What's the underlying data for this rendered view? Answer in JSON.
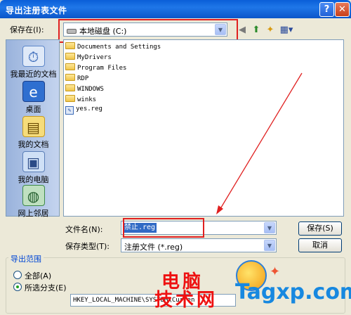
{
  "window": {
    "title": "导出注册表文件",
    "help": "?",
    "close": "✕"
  },
  "save_in": {
    "label": "保存在(I):",
    "value": "本地磁盘 (C:)"
  },
  "places": [
    {
      "label": "我最近的文档",
      "icon": "recent-documents-icon"
    },
    {
      "label": "桌面",
      "icon": "desktop-icon"
    },
    {
      "label": "我的文档",
      "icon": "my-documents-icon"
    },
    {
      "label": "我的电脑",
      "icon": "my-computer-icon"
    },
    {
      "label": "网上邻居",
      "icon": "network-places-icon"
    }
  ],
  "files": [
    {
      "name": "Documents and Settings",
      "type": "folder"
    },
    {
      "name": "MyDrivers",
      "type": "folder"
    },
    {
      "name": "Program Files",
      "type": "folder"
    },
    {
      "name": "RDP",
      "type": "folder"
    },
    {
      "name": "WINDOWS",
      "type": "folder"
    },
    {
      "name": "winks",
      "type": "folder"
    },
    {
      "name": "yes.reg",
      "type": "reg"
    }
  ],
  "filename": {
    "label": "文件名(N):",
    "value": "禁止.reg"
  },
  "filetype": {
    "label": "保存类型(T):",
    "value": "注册文件 (*.reg)"
  },
  "buttons": {
    "save": "保存(S)",
    "cancel": "取消"
  },
  "export_range": {
    "title": "导出范围",
    "all": "全部(A)",
    "branch": "所选分支(E)",
    "branch_value": "HKEY_LOCAL_MACHINE\\SYSTEM\\Curren"
  },
  "watermark": {
    "line1": "电脑",
    "line2": "技术网",
    "site": "Tagxp.com"
  },
  "colors": {
    "annotation": "#e02020",
    "title_bar": "#0a5fd8",
    "watermark_red": "#e11111",
    "watermark_blue": "#1788e0"
  }
}
